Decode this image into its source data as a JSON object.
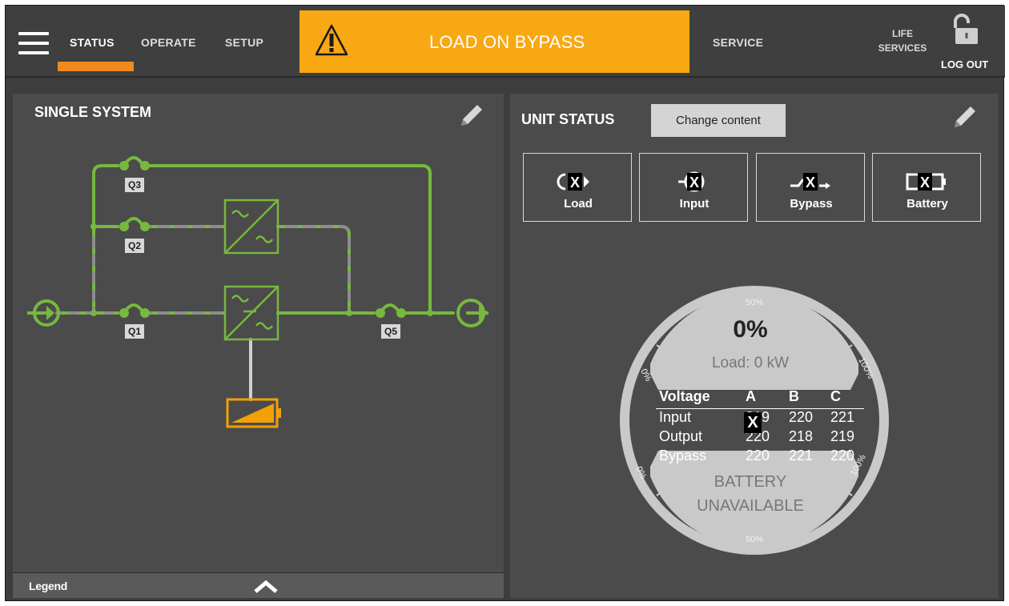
{
  "nav": {
    "status": "STATUS",
    "operate": "OPERATE",
    "setup": "SETUP",
    "service": "SERVICE",
    "life_services_line1": "LIFE",
    "life_services_line2": "SERVICES",
    "logout": "LOG OUT"
  },
  "alarm": {
    "text": "LOAD ON BYPASS",
    "color": "#f8a812"
  },
  "colors": {
    "accent": "#f08a1c",
    "path_green": "#77b83f",
    "battery": "#f2a007"
  },
  "left_panel": {
    "title": "SINGLE SYSTEM",
    "switches": [
      "Q3",
      "Q2",
      "Q1",
      "Q5"
    ],
    "legend": "Legend"
  },
  "right_panel": {
    "title": "UNIT STATUS",
    "change_content": "Change content",
    "tiles": [
      {
        "label": "Load",
        "icon": "load-icon"
      },
      {
        "label": "Input",
        "icon": "input-icon"
      },
      {
        "label": "Bypass",
        "icon": "bypass-icon"
      },
      {
        "label": "Battery",
        "icon": "battery-icon"
      }
    ],
    "gauge": {
      "percent": "0%",
      "load": "Load: 0 kW",
      "scale_top": "50%",
      "scale_bottom": "50%",
      "scale_upper_left": "0%",
      "scale_upper_right": "100%",
      "scale_lower_left": "0%",
      "scale_lower_right": "100%",
      "battery_line1": "BATTERY",
      "battery_line2": "UNAVAILABLE"
    },
    "voltage": {
      "headers": [
        "Voltage",
        "A",
        "B",
        "C"
      ],
      "rows": [
        {
          "label": "Input",
          "a": "219",
          "b": "220",
          "c": "221"
        },
        {
          "label": "Output",
          "a": "220",
          "b": "218",
          "c": "219"
        },
        {
          "label": "Bypass",
          "a": "220",
          "b": "221",
          "c": "220"
        }
      ]
    }
  }
}
